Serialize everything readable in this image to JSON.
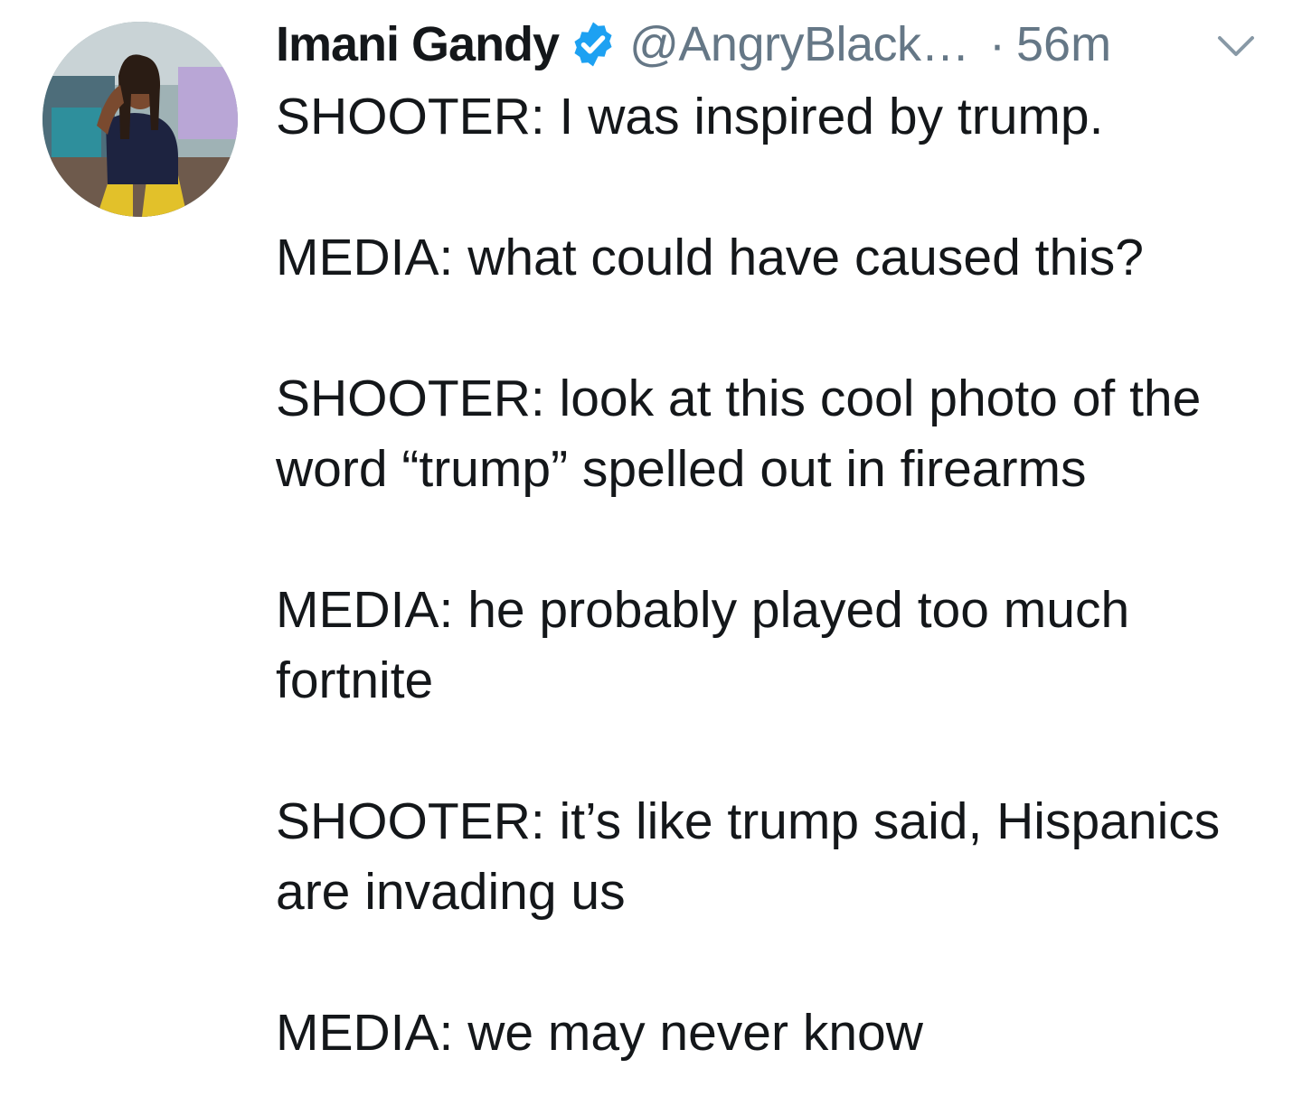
{
  "tweet": {
    "author": {
      "display_name": "Imani Gandy",
      "handle": "@AngryBlack…",
      "verified": true,
      "avatar_icon": "avatar-photo"
    },
    "separator": "·",
    "time": "56m",
    "menu_icon": "chevron-down-icon",
    "verified_color": "#1da1f2",
    "paragraphs": [
      "SHOOTER: I was inspired by trump.",
      "MEDIA: what could have caused this?",
      "SHOOTER: look at this cool photo of the word “trump” spelled out in firearms",
      "MEDIA: he probably played too much fortnite",
      "SHOOTER: it’s like trump said, Hispanics are invading us",
      "MEDIA: we may never know"
    ]
  }
}
